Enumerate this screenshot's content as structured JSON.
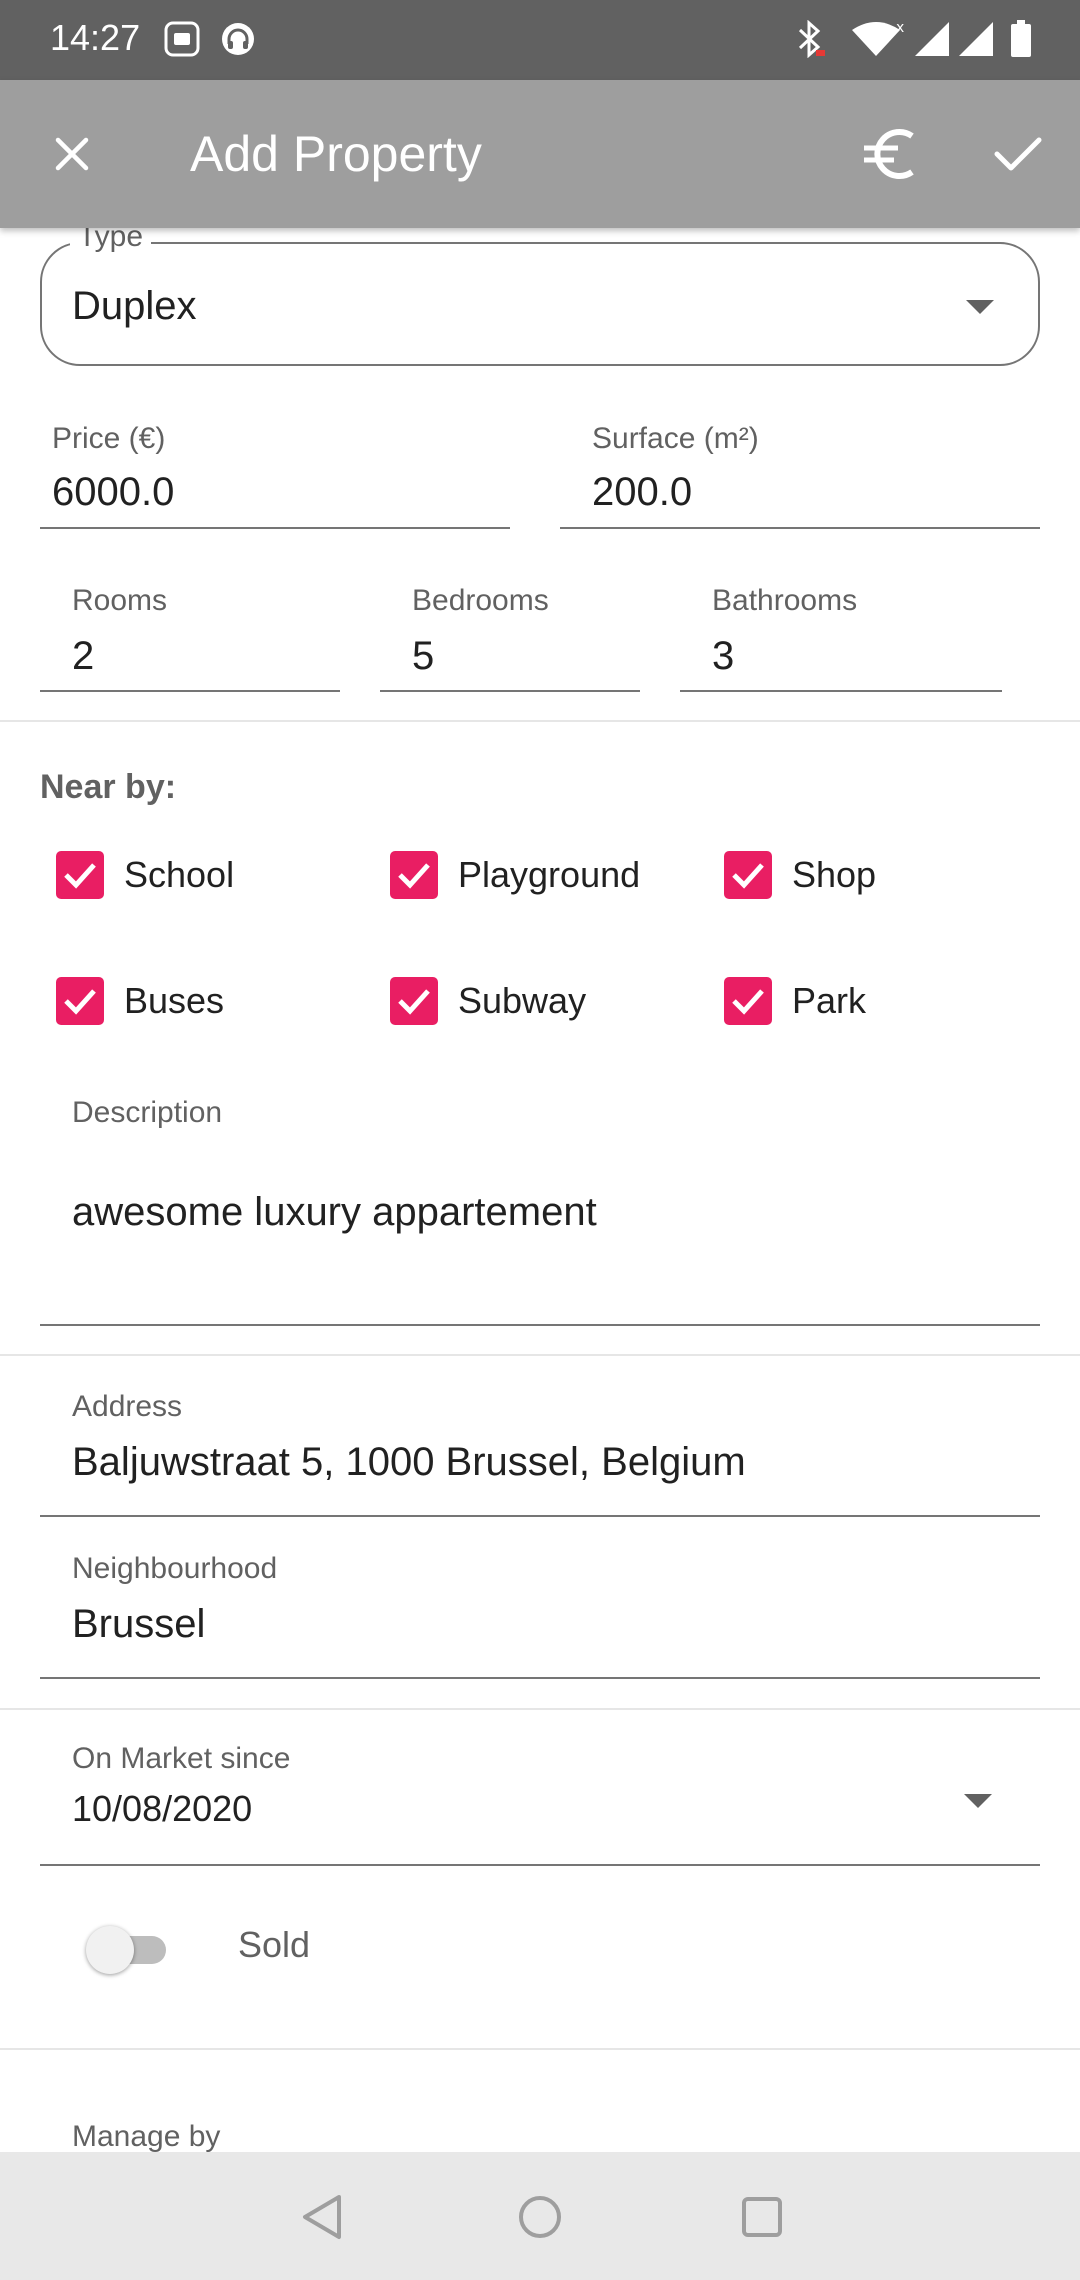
{
  "status_bar": {
    "time": "14:27",
    "icons": [
      "notification-badge-icon",
      "headset-icon",
      "bluetooth-icon",
      "wifi-icon",
      "signal-icon",
      "signal-icon",
      "battery-icon"
    ]
  },
  "app_bar": {
    "title": "Add Property",
    "close_icon": "close-icon",
    "currency_icon": "euro-icon",
    "confirm_icon": "check-icon"
  },
  "form": {
    "type": {
      "label": "Type",
      "value": "Duplex"
    },
    "price": {
      "label": "Price (€)",
      "value": "6000.0"
    },
    "surface": {
      "label": "Surface (m²)",
      "value": "200.0"
    },
    "rooms": {
      "label": "Rooms",
      "value": "2"
    },
    "bedrooms": {
      "label": "Bedrooms",
      "value": "5"
    },
    "bathrooms": {
      "label": "Bathrooms",
      "value": "3"
    },
    "nearby": {
      "title": "Near by:",
      "items": [
        {
          "label": "School",
          "checked": true
        },
        {
          "label": "Playground",
          "checked": true
        },
        {
          "label": "Shop",
          "checked": true
        },
        {
          "label": "Buses",
          "checked": true
        },
        {
          "label": "Subway",
          "checked": true
        },
        {
          "label": "Park",
          "checked": true
        }
      ]
    },
    "description": {
      "label": "Description",
      "value": "awesome luxury appartement"
    },
    "address": {
      "label": "Address",
      "value": "Baljuwstraat 5, 1000 Brussel, Belgium"
    },
    "neighbourhood": {
      "label": "Neighbourhood",
      "value": "Brussel"
    },
    "market_since": {
      "label": "On Market since",
      "value": "10/08/2020"
    },
    "sold": {
      "label": "Sold",
      "checked": false
    },
    "manage_by": {
      "label": "Manage by"
    }
  },
  "colors": {
    "accent": "#e91e63",
    "app_bar": "#9e9e9e",
    "status_bar": "#616161"
  },
  "nav_bar": {
    "icons": [
      "back-icon",
      "home-icon",
      "recents-icon"
    ]
  }
}
